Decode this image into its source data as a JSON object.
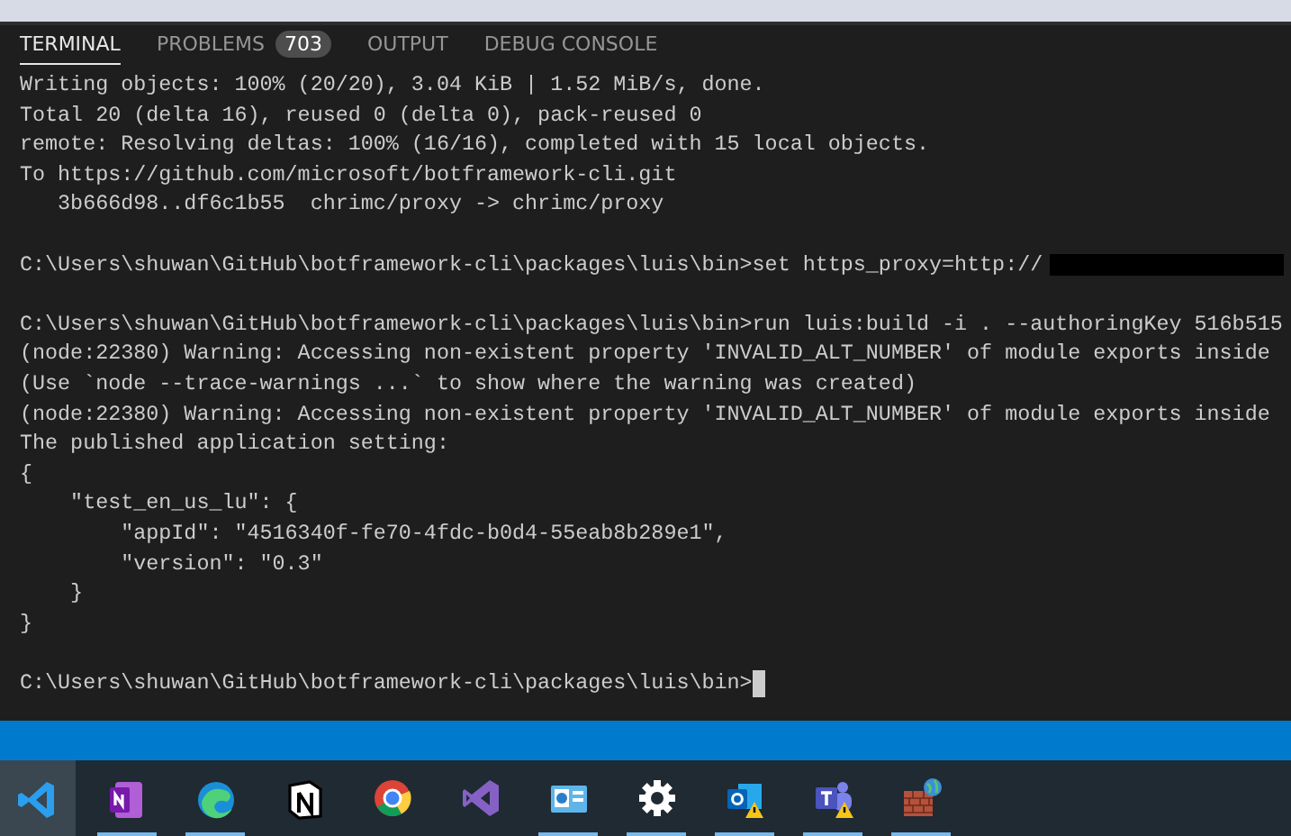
{
  "panel": {
    "tabs": [
      {
        "label": "TERMINAL",
        "selected": true
      },
      {
        "label": "PROBLEMS",
        "selected": false,
        "badge": "703"
      },
      {
        "label": "OUTPUT",
        "selected": false
      },
      {
        "label": "DEBUG CONSOLE",
        "selected": false
      }
    ]
  },
  "terminal": {
    "lines": [
      {
        "kind": "text",
        "text": "Writing objects: 100% (20/20), 3.04 KiB | 1.52 MiB/s, done."
      },
      {
        "kind": "text",
        "text": "Total 20 (delta 16), reused 0 (delta 0), pack-reused 0"
      },
      {
        "kind": "text",
        "text": "remote: Resolving deltas: 100% (16/16), completed with 15 local objects."
      },
      {
        "kind": "text",
        "text": "To https://github.com/microsoft/botframework-cli.git"
      },
      {
        "kind": "text",
        "text": "   3b666d98..df6c1b55  chrimc/proxy -> chrimc/proxy"
      },
      {
        "kind": "blank"
      },
      {
        "kind": "redacted",
        "text": "C:\\Users\\shuwan\\GitHub\\botframework-cli\\packages\\luis\\bin>set https_proxy=http://"
      },
      {
        "kind": "blank"
      },
      {
        "kind": "text",
        "text": "C:\\Users\\shuwan\\GitHub\\botframework-cli\\packages\\luis\\bin>run luis:build -i . --authoringKey 516b515"
      },
      {
        "kind": "text",
        "text": "(node:22380) Warning: Accessing non-existent property 'INVALID_ALT_NUMBER' of module exports inside"
      },
      {
        "kind": "text",
        "text": "(Use `node --trace-warnings ...` to show where the warning was created)"
      },
      {
        "kind": "text",
        "text": "(node:22380) Warning: Accessing non-existent property 'INVALID_ALT_NUMBER' of module exports inside"
      },
      {
        "kind": "text",
        "text": "The published application setting:"
      },
      {
        "kind": "text",
        "text": "{"
      },
      {
        "kind": "text",
        "text": "    \"test_en_us_lu\": {"
      },
      {
        "kind": "text",
        "text": "        \"appId\": \"4516340f-fe70-4fdc-b0d4-55eab8b289e1\","
      },
      {
        "kind": "text",
        "text": "        \"version\": \"0.3\""
      },
      {
        "kind": "text",
        "text": "    }"
      },
      {
        "kind": "text",
        "text": "}"
      },
      {
        "kind": "blank"
      },
      {
        "kind": "prompt",
        "text": "C:\\Users\\shuwan\\GitHub\\botframework-cli\\packages\\luis\\bin>"
      }
    ]
  },
  "taskbar": {
    "apps": [
      {
        "kind": "ribbon",
        "active": true,
        "running": false
      },
      {
        "kind": "notebook",
        "active": false,
        "running": true
      },
      {
        "kind": "swirl",
        "active": false,
        "running": true
      },
      {
        "kind": "cube",
        "active": false,
        "running": false
      },
      {
        "kind": "wheel",
        "active": false,
        "running": false
      },
      {
        "kind": "infinity",
        "active": false,
        "running": false
      },
      {
        "kind": "panel",
        "active": false,
        "running": true
      },
      {
        "kind": "gear",
        "active": false,
        "running": true
      },
      {
        "kind": "mail",
        "active": false,
        "running": true
      },
      {
        "kind": "team",
        "active": false,
        "running": true
      },
      {
        "kind": "wall",
        "active": false,
        "running": true
      }
    ]
  }
}
